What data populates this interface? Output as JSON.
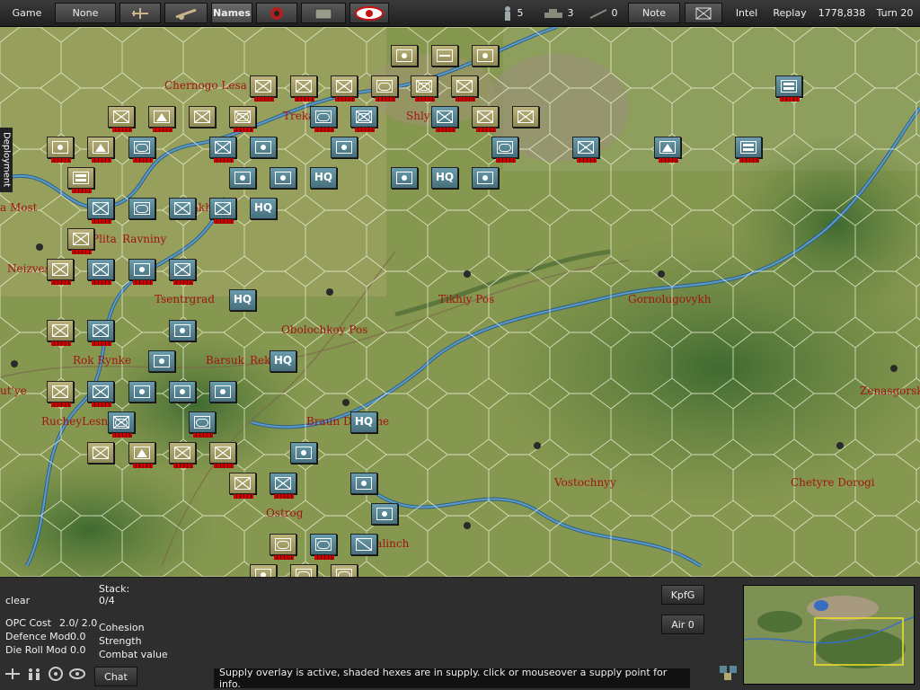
{
  "topbar": {
    "game": "Game",
    "none": "None",
    "names": "Names",
    "infantry_count": "5",
    "tank_count": "3",
    "art_count": "0",
    "note": "Note",
    "intel": "Intel",
    "replay": "Replay",
    "points": "1778,838",
    "turn": "Turn 20"
  },
  "sidetab": "Deployment",
  "towns": [
    {
      "name": "Chernogo Lesa"
    },
    {
      "name": "Trekales"
    },
    {
      "name": "Shlyuz"
    },
    {
      "name": "a Most"
    },
    {
      "name": "Strakh Kivi"
    },
    {
      "name": "Plita"
    },
    {
      "name": "Ravniny"
    },
    {
      "name": "Neizvestnyy"
    },
    {
      "name": "Tsentrgrad"
    },
    {
      "name": "Tikhiy Pos"
    },
    {
      "name": "Gornolugovykh"
    },
    {
      "name": "Obolochkoy Pos"
    },
    {
      "name": "Rok Rynke"
    },
    {
      "name": "Barsuk"
    },
    {
      "name": "Reka"
    },
    {
      "name": "ut'ye"
    },
    {
      "name": "Zenasgorsk"
    },
    {
      "name": "RucheyLesnoy"
    },
    {
      "name": "Braun Derevne"
    },
    {
      "name": "Vostochnyy"
    },
    {
      "name": "Chetyre Dorogi"
    },
    {
      "name": "Ostrog"
    },
    {
      "name": "Malinch"
    }
  ],
  "hq_label": "HQ",
  "panel": {
    "terrain": "clear",
    "stack_label": "Stack:",
    "stack_value": "0/4",
    "opc_label": "OPC Cost",
    "opc_value": "2.0/ 2.0",
    "defence_label": "Defence Mod",
    "defence_value": "0.0",
    "dieroll_label": "Die Roll Mod",
    "dieroll_value": "0.0",
    "cohesion": "Cohesion",
    "strength": "Strength",
    "combat": "Combat value",
    "chat": "Chat",
    "kpfg": "KpfG",
    "air": "Air 0",
    "status": "Supply overlay is active, shaded hexes are in supply. click or mouseover a supply point for info."
  },
  "colors": {
    "axis": "#b1aa72",
    "soviet": "#5a8797",
    "town_text": "#a31414"
  }
}
